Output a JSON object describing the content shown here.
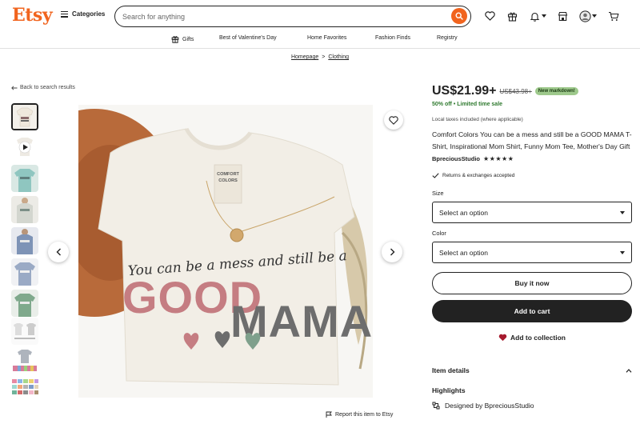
{
  "header": {
    "logo": "Etsy",
    "categories_label": "Categories",
    "search_placeholder": "Search for anything"
  },
  "subnav": {
    "items": [
      "Gifts",
      "Best of Valentine's Day",
      "Home Favorites",
      "Fashion Finds",
      "Registry"
    ]
  },
  "breadcrumb": {
    "items": [
      "Homepage",
      "Clothing"
    ],
    "separator": ">"
  },
  "back_link": "Back to search results",
  "listing": {
    "price": "US$21.99+",
    "old_price": "US$43.98+",
    "markdown_badge": "New markdown!",
    "discount": "50% off • Limited time sale",
    "taxes": "Local taxes included (where applicable)",
    "title": "Comfort Colors You can be a mess and still be a GOOD MAMA T-Shirt, Inspirational Mom Shirt, Funny Mom Tee, Mother's Day Gift",
    "shop_name": "BpreciousStudio",
    "stars": "★★★★★",
    "returns": "Returns & exchanges accepted",
    "size_label": "Size",
    "size_value": "Select an option",
    "color_label": "Color",
    "color_value": "Select an option",
    "buy_now": "Buy it now",
    "add_to_cart": "Add to cart",
    "add_to_collection": "Add to collection",
    "item_details": "Item details",
    "highlights": "Highlights",
    "designed_by": "Designed by BpreciousStudio"
  },
  "report_label": "Report this item to Etsy",
  "image": {
    "line1": "You can be a mess and still be a",
    "line2a": "GOOD",
    "line2b": "MAMA",
    "tag_line1": "COMFORT",
    "tag_line2": "COLORS"
  },
  "colors": {
    "brand": "#f1641e",
    "discount_green": "#2f7a2f",
    "badge_green": "#9ec98c",
    "dark": "#222222"
  }
}
